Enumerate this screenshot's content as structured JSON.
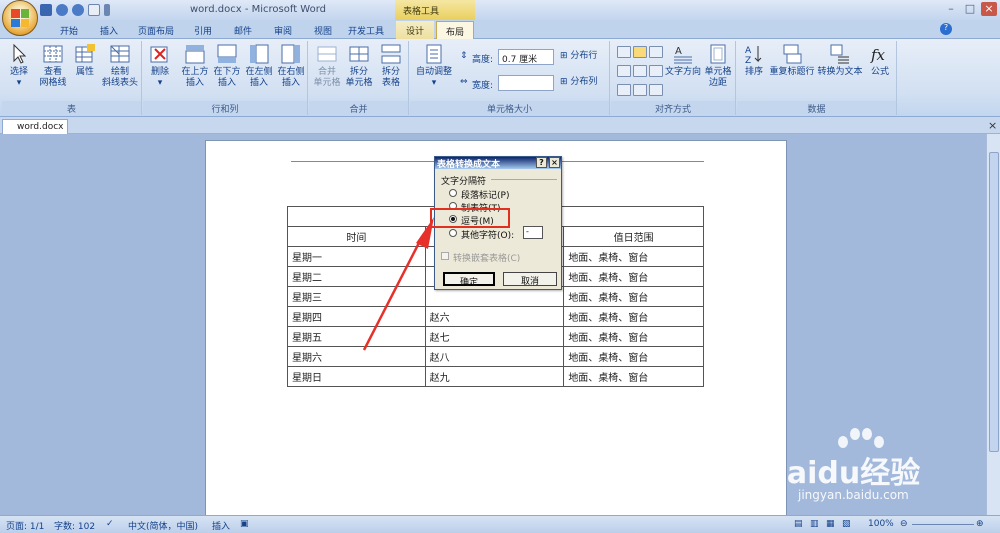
{
  "window": {
    "title": "word.docx - Microsoft Word",
    "context_title": "表格工具"
  },
  "tabs": [
    "开始",
    "插入",
    "页面布局",
    "引用",
    "邮件",
    "审阅",
    "视图",
    "开发工具",
    "设计",
    "布局"
  ],
  "ribbon": {
    "groups": [
      "表",
      "行和列",
      "合并",
      "单元格大小",
      "对齐方式",
      "数据"
    ],
    "table": [
      {
        "l1": "选择",
        "l2": "▾"
      },
      {
        "l1": "查看",
        "l2": "网格线"
      },
      {
        "l1": "属性",
        "l2": ""
      },
      {
        "l1": "绘制",
        "l2": "斜线表头"
      }
    ],
    "rows": [
      {
        "l1": "删除",
        "l2": "▾"
      },
      {
        "l1": "在上方",
        "l2": "插入"
      },
      {
        "l1": "在下方",
        "l2": "插入"
      },
      {
        "l1": "在左侧",
        "l2": "插入"
      },
      {
        "l1": "在右侧",
        "l2": "插入"
      }
    ],
    "merge": [
      {
        "l1": "合并",
        "l2": "单元格"
      },
      {
        "l1": "拆分",
        "l2": "单元格"
      },
      {
        "l1": "拆分",
        "l2": "表格"
      }
    ],
    "size": {
      "autofit": "自动调整",
      "height_label": "高度:",
      "height_value": "0.7 厘米",
      "width_label": "宽度:",
      "width_value": "",
      "dist_rows": "分布行",
      "dist_cols": "分布列"
    },
    "align": {
      "text_dir": "文字方向",
      "margins_l1": "单元格",
      "margins_l2": "边距"
    },
    "data": [
      {
        "l1": "排序"
      },
      {
        "l1": "重复标题行"
      },
      {
        "l1": "转换为文本"
      },
      {
        "l1": "公式"
      }
    ]
  },
  "doc_tab": "word.docx",
  "table": {
    "header": [
      "时间",
      "",
      "值日范围"
    ],
    "rows": [
      [
        "星期一",
        "",
        "地面、桌椅、窗台"
      ],
      [
        "星期二",
        "",
        "地面、桌椅、窗台"
      ],
      [
        "星期三",
        "",
        "地面、桌椅、窗台"
      ],
      [
        "星期四",
        "赵六",
        "地面、桌椅、窗台"
      ],
      [
        "星期五",
        "赵七",
        "地面、桌椅、窗台"
      ],
      [
        "星期六",
        "赵八",
        "地面、桌椅、窗台"
      ],
      [
        "星期日",
        "赵九",
        "地面、桌椅、窗台"
      ]
    ]
  },
  "dialog": {
    "title": "表格转换成文本",
    "help": "?",
    "close": "×",
    "group_label": "文字分隔符",
    "options": [
      "段落标记(P)",
      "制表符(T)",
      "逗号(M)",
      "其他字符(O):"
    ],
    "selected_index": 2,
    "other_value": "-",
    "nested_label": "转换嵌套表格(C)",
    "ok": "确定",
    "cancel": "取消"
  },
  "status": {
    "page": "页面: 1/1",
    "words": "字数: 102",
    "lang": "中文(简体，中国)",
    "mode": "插入",
    "zoom": "100%"
  },
  "watermark": {
    "brand": "Baidu经验",
    "url": "jingyan.baidu.com"
  },
  "colors": {
    "highlight": "#e03020",
    "arrow": "#e8302a"
  }
}
